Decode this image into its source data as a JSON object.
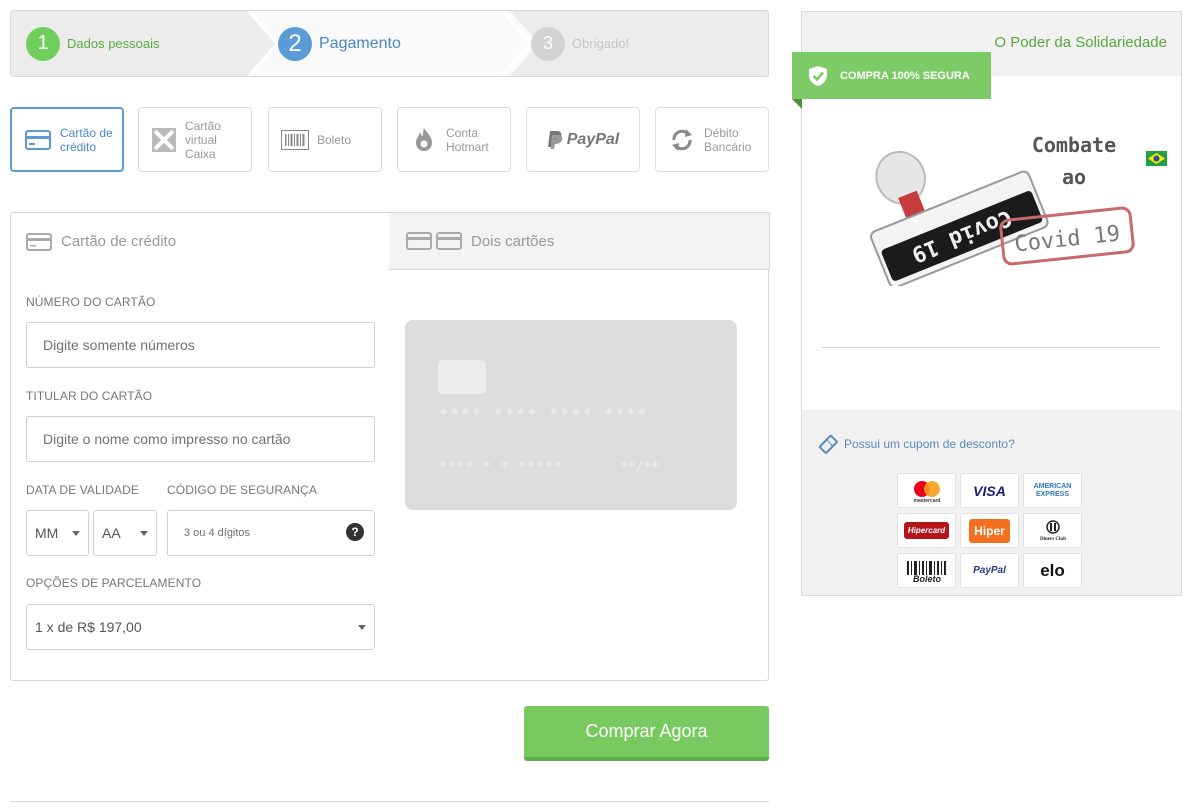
{
  "steps": [
    {
      "num": "1",
      "label": "Dados pessoais"
    },
    {
      "num": "2",
      "label": "Pagamento"
    },
    {
      "num": "3",
      "label": "Obrigado!"
    }
  ],
  "methods": [
    {
      "label_1": "Cartão de",
      "label_2": "crédito",
      "icon": "credit-card-icon"
    },
    {
      "label_1": "Cartão virtual",
      "label_2": "Caixa",
      "icon": "caixa-icon"
    },
    {
      "label_1": "Boleto",
      "label_2": "",
      "icon": "barcode-icon"
    },
    {
      "label_1": "Conta",
      "label_2": "Hotmart",
      "icon": "hotmart-flame-icon"
    },
    {
      "label_1": "PayPal",
      "label_2": "",
      "icon": "paypal-icon"
    },
    {
      "label_1": "Débito",
      "label_2": "Bancário",
      "icon": "refresh-icon"
    }
  ],
  "tabs": {
    "credit_card": "Cartão de crédito",
    "two_cards": "Dois cartões"
  },
  "form": {
    "card_number_label": "NÚMERO DO CARTÃO",
    "card_number_placeholder": "Digite somente números",
    "holder_label": "TITULAR DO CARTÃO",
    "holder_placeholder": "Digite o nome como impresso no cartão",
    "expiry_label": "DATA DE VALIDADE",
    "month_value": "MM",
    "year_value": "AA",
    "cvv_label": "CÓDIGO DE SEGURANÇA",
    "cvv_placeholder": "3 ou 4 dígitos",
    "installments_label": "OPÇÕES DE PARCELAMENTO",
    "installments_value": "1 x de R$ 197,00"
  },
  "card_preview": {
    "number": "**** **** **** ****",
    "name": "**** * * *****",
    "expiry": "**/**"
  },
  "buy_button": "Comprar Agora",
  "side": {
    "title": "O Poder da Solidariedade",
    "secure_badge": "COMPRA 100% SEGURA",
    "product_image_text": {
      "stamp": "Covid 19",
      "line1": "Combate",
      "line2": "ao",
      "line3": "Covid 19"
    },
    "coupon": "Possui um cupom de desconto?"
  },
  "brands": [
    "mastercard",
    "VISA",
    "AMERICAN EXPRESS",
    "Hipercard",
    "Hiper",
    "Diners Club",
    "Boleto",
    "PayPal",
    "elo"
  ],
  "colors": {
    "green": "#77c960",
    "blue": "#5b9bd5",
    "green_text": "#5aa83d"
  }
}
